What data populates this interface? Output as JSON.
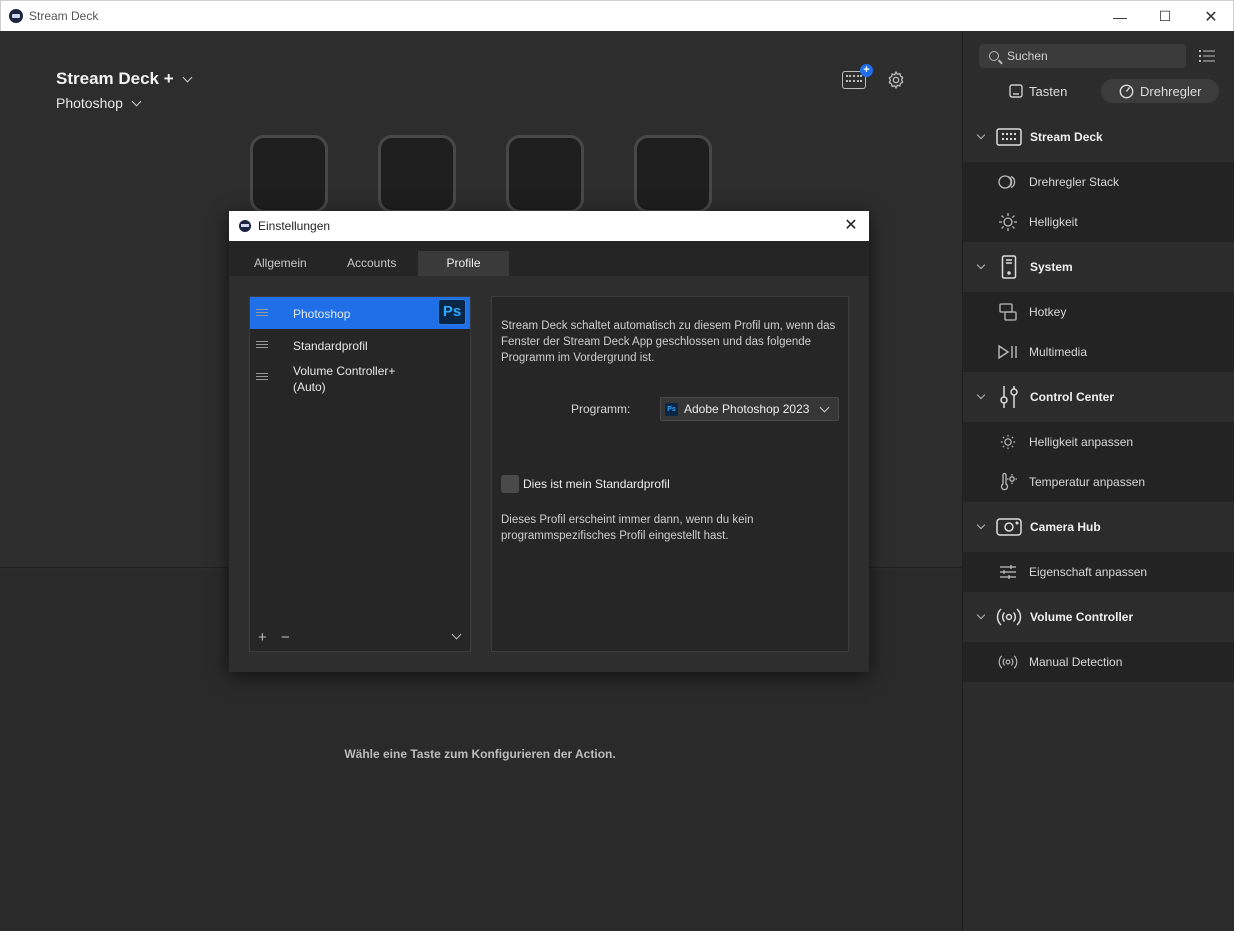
{
  "window": {
    "title": "Stream Deck"
  },
  "header": {
    "device": "Stream Deck +",
    "profile": "Photoshop"
  },
  "main": {
    "hint": "Wähle eine Taste zum Konfigurieren der Action."
  },
  "sidebar": {
    "search_placeholder": "Suchen",
    "segments": {
      "keys": "Tasten",
      "dials": "Drehregler"
    },
    "categories": [
      {
        "label": "Stream Deck",
        "items": [
          "Drehregler Stack",
          "Helligkeit"
        ]
      },
      {
        "label": "System",
        "items": [
          "Hotkey",
          "Multimedia"
        ]
      },
      {
        "label": "Control Center",
        "items": [
          "Helligkeit anpassen",
          "Temperatur anpassen"
        ]
      },
      {
        "label": "Camera Hub",
        "items": [
          "Eigenschaft anpassen"
        ]
      },
      {
        "label": "Volume Controller",
        "items": [
          "Manual Detection"
        ]
      }
    ]
  },
  "dialog": {
    "title": "Einstellungen",
    "tabs": [
      "Allgemein",
      "Accounts",
      "Profile"
    ],
    "active_tab": "Profile",
    "profiles": [
      {
        "line1": "Photoshop",
        "line2": "",
        "badge": "Ps"
      },
      {
        "line1": "Standardprofil",
        "line2": ""
      },
      {
        "line1": "Volume Controller+",
        "line2": "(Auto)"
      }
    ],
    "list_footer": {
      "add": "+",
      "remove": "−"
    },
    "description": "Stream Deck schaltet automatisch zu diesem Profil um, wenn das Fenster der Stream Deck App geschlossen und das folgende Programm im Vordergrund ist.",
    "program_label": "Programm:",
    "program_value": "Adobe Photoshop 2023",
    "program_badge": "Ps",
    "default_checkbox_label": "Dies ist mein Standardprofil",
    "default_description": "Dieses Profil erscheint immer dann, wenn du kein programmspezifisches Profil eingestellt hast."
  },
  "colors": {
    "accent": "#1e6fe8",
    "photoshop": "#31a8ff"
  }
}
